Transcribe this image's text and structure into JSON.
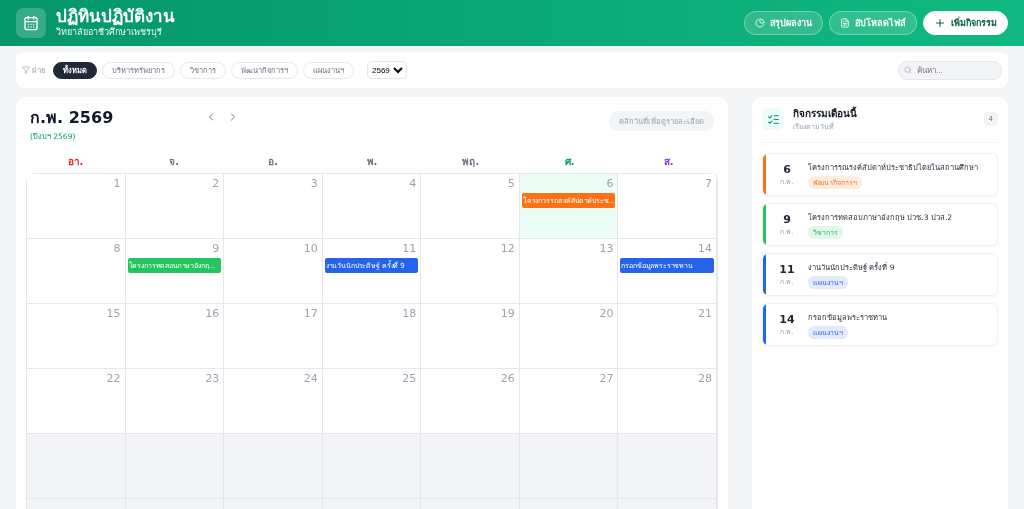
{
  "header": {
    "title": "ปฏิทินปฏิบัติงาน",
    "subtitle": "วิทยาลัยอาชีวศึกษาเพชรบุรี",
    "buttons": [
      {
        "kind": "chart",
        "label": "สรุปผลงาน"
      },
      {
        "kind": "file",
        "label": "อัปโหลดไฟล์"
      },
      {
        "kind": "add",
        "label": "เพิ่มกิจกรรม"
      }
    ]
  },
  "filters": {
    "label": "ฝ่าย",
    "chips": [
      {
        "label": "ทั้งหมด",
        "selected": true
      },
      {
        "label": "บริหารทรัพยากร",
        "selected": false
      },
      {
        "label": "วิชาการ",
        "selected": false
      },
      {
        "label": "พัฒนากิจการฯ",
        "selected": false
      },
      {
        "label": "แผนงานฯ",
        "selected": false
      }
    ],
    "year": "2569",
    "search": {
      "placeholder": "ค้นหา..."
    }
  },
  "calendar": {
    "title": "ก.พ. 2569",
    "fiscal_year": "(ปีงบฯ 2569)",
    "hint": "คลิกวันที่เพื่อดูรายละเอียด",
    "weekdays": [
      {
        "label": "อา.",
        "color": "#dc2626"
      },
      {
        "label": "จ.",
        "color": "#6b7280"
      },
      {
        "label": "อ.",
        "color": "#6b7280"
      },
      {
        "label": "พ.",
        "color": "#6b7280"
      },
      {
        "label": "พฤ.",
        "color": "#6b7280"
      },
      {
        "label": "ศ.",
        "color": "#059669"
      },
      {
        "label": "ส.",
        "color": "#9333ea"
      }
    ],
    "days": [
      {
        "day": "1",
        "selected": false
      },
      {
        "day": "2",
        "selected": false
      },
      {
        "day": "3",
        "selected": false
      },
      {
        "day": "4",
        "selected": false
      },
      {
        "day": "5",
        "selected": false
      },
      {
        "day": "6",
        "selected": true,
        "events": [
          {
            "label": "โครงการรณรงค์สัปดาห์ประช...",
            "color": "#f97316"
          }
        ]
      },
      {
        "day": "7",
        "selected": false
      },
      {
        "day": "8",
        "selected": false
      },
      {
        "day": "9",
        "selected": false,
        "events": [
          {
            "label": "โครงการทดสอบภาษาอังกฤ...",
            "color": "#22c55e"
          }
        ]
      },
      {
        "day": "10",
        "selected": false
      },
      {
        "day": "11",
        "selected": false,
        "events": [
          {
            "label": "งานวันนักประดิษฐ์ ครั้งที่ 9",
            "color": "#2563eb"
          }
        ]
      },
      {
        "day": "12",
        "selected": false
      },
      {
        "day": "13",
        "selected": false
      },
      {
        "day": "14",
        "selected": false,
        "events": [
          {
            "label": "กรอกข้อมูลพระราชทาน",
            "color": "#2563eb"
          }
        ]
      },
      {
        "day": "15",
        "selected": false
      },
      {
        "day": "16",
        "selected": false
      },
      {
        "day": "17",
        "selected": false
      },
      {
        "day": "18",
        "selected": false
      },
      {
        "day": "19",
        "selected": false
      },
      {
        "day": "20",
        "selected": false
      },
      {
        "day": "21",
        "selected": false
      },
      {
        "day": "22",
        "selected": false
      },
      {
        "day": "23",
        "selected": false
      },
      {
        "day": "24",
        "selected": false
      },
      {
        "day": "25",
        "selected": false
      },
      {
        "day": "26",
        "selected": false
      },
      {
        "day": "27",
        "selected": false
      },
      {
        "day": "28",
        "selected": false
      }
    ]
  },
  "sidebar": {
    "title": "กิจกรรมเดือนนี้",
    "subtitle": "เรียงตามวันที่",
    "count": "4",
    "items": [
      {
        "day": "6",
        "month": "ก.พ.",
        "title": "โครงการรณรงค์สัปดาห์ประชาธิปไตยในสถานศึกษา",
        "tag": "พัฒนากิจการฯ",
        "color": "#f97316"
      },
      {
        "day": "9",
        "month": "ก.พ.",
        "title": "โครงการทดสอบภาษาอังกฤษ ปวช.3 ปวส.2",
        "tag": "วิชาการ",
        "color": "#22c55e"
      },
      {
        "day": "11",
        "month": "ก.พ.",
        "title": "งานวันนักประดิษฐ์ ครั้งที่ 9",
        "tag": "แผนงานฯ",
        "color": "#2563eb"
      },
      {
        "day": "14",
        "month": "ก.พ.",
        "title": "กรอกข้อมูลพระราชทาน",
        "tag": "แผนงานฯ",
        "color": "#2563eb"
      }
    ]
  }
}
